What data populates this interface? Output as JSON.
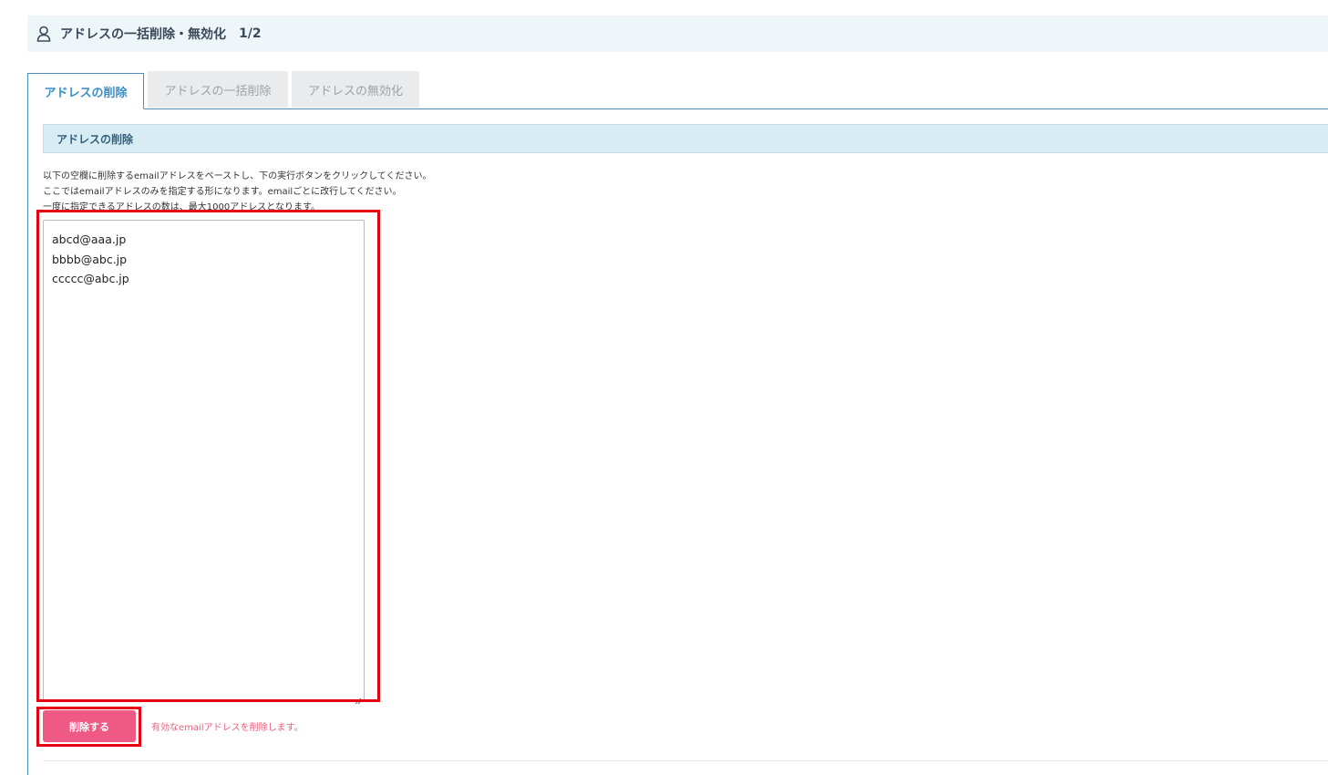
{
  "header": {
    "title": "アドレスの一括削除・無効化",
    "step": "1/2",
    "icon": "user-icon"
  },
  "tabs": [
    {
      "label": "アドレスの削除",
      "active": true
    },
    {
      "label": "アドレスの一括削除",
      "active": false
    },
    {
      "label": "アドレスの無効化",
      "active": false
    }
  ],
  "section": {
    "title": "アドレスの削除"
  },
  "instructions": [
    "以下の空欄に削除するemailアドレスをペーストし、下の実行ボタンをクリックしてください。",
    "ここではemailアドレスのみを指定する形になります。emailごとに改行してください。",
    "一度に指定できるアドレスの数は、最大1000アドレスとなります。"
  ],
  "textarea": {
    "lines": [
      "abcd@aaa.jp",
      "bbbb@abc.jp",
      "ccccc@abc.jp"
    ]
  },
  "action": {
    "button_label": "削除する",
    "note": "有効なemailアドレスを削除します。"
  },
  "colors": {
    "accent": "#3a8fc6",
    "button": "#ee5a85",
    "highlight": "#e60012",
    "note": "#e8607f"
  }
}
